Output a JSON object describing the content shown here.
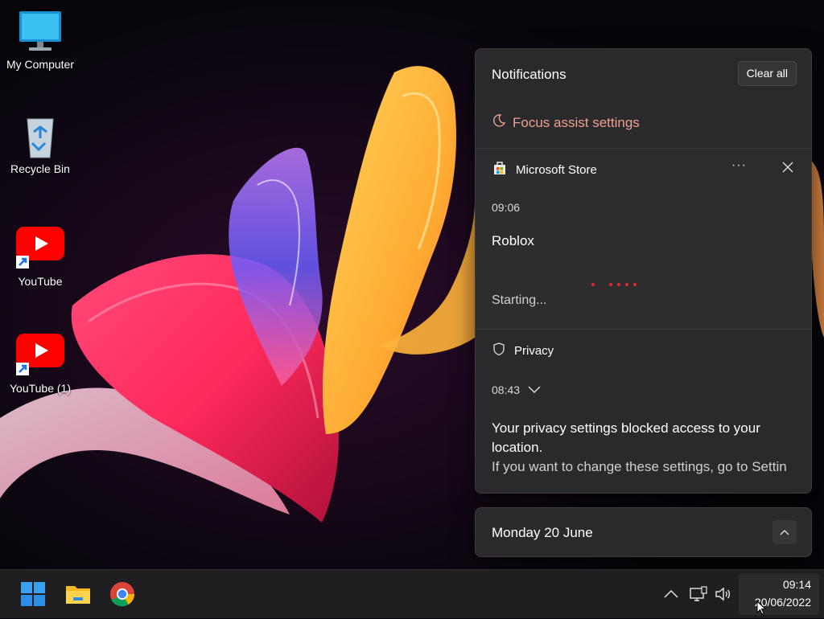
{
  "desktop": {
    "icons": [
      {
        "label": "My Computer",
        "icon": "monitor-icon"
      },
      {
        "label": "Recycle Bin",
        "icon": "recycle-bin-icon"
      },
      {
        "label": "YouTube",
        "icon": "youtube-icon"
      },
      {
        "label": "YouTube (1)",
        "icon": "youtube-icon"
      }
    ]
  },
  "notifications": {
    "title": "Notifications",
    "clear_all_label": "Clear all",
    "focus_assist_label": "Focus assist settings",
    "items": [
      {
        "app": "Microsoft Store",
        "time": "09:06",
        "title": "Roblox",
        "status": "Starting...",
        "more_label": "···"
      },
      {
        "app": "Privacy",
        "time": "08:43",
        "body": "Your privacy settings blocked access to your location.",
        "detail": "If you want to change these settings, go to Settin"
      }
    ]
  },
  "calendar": {
    "date_label": "Monday 20 June"
  },
  "taskbar": {
    "apps": [
      "start-icon",
      "file-explorer-icon",
      "chrome-icon"
    ],
    "tray": [
      "chevron-up-icon",
      "network-icon",
      "volume-icon"
    ],
    "clock_time": "09:14",
    "clock_date": "20/06/2022"
  },
  "colors": {
    "accent": "#f0a08e",
    "panel": "#2a2a2c",
    "taskbar": "#1f1f21",
    "youtube_red": "#ff0000",
    "loading_dots": "#e0282f"
  }
}
